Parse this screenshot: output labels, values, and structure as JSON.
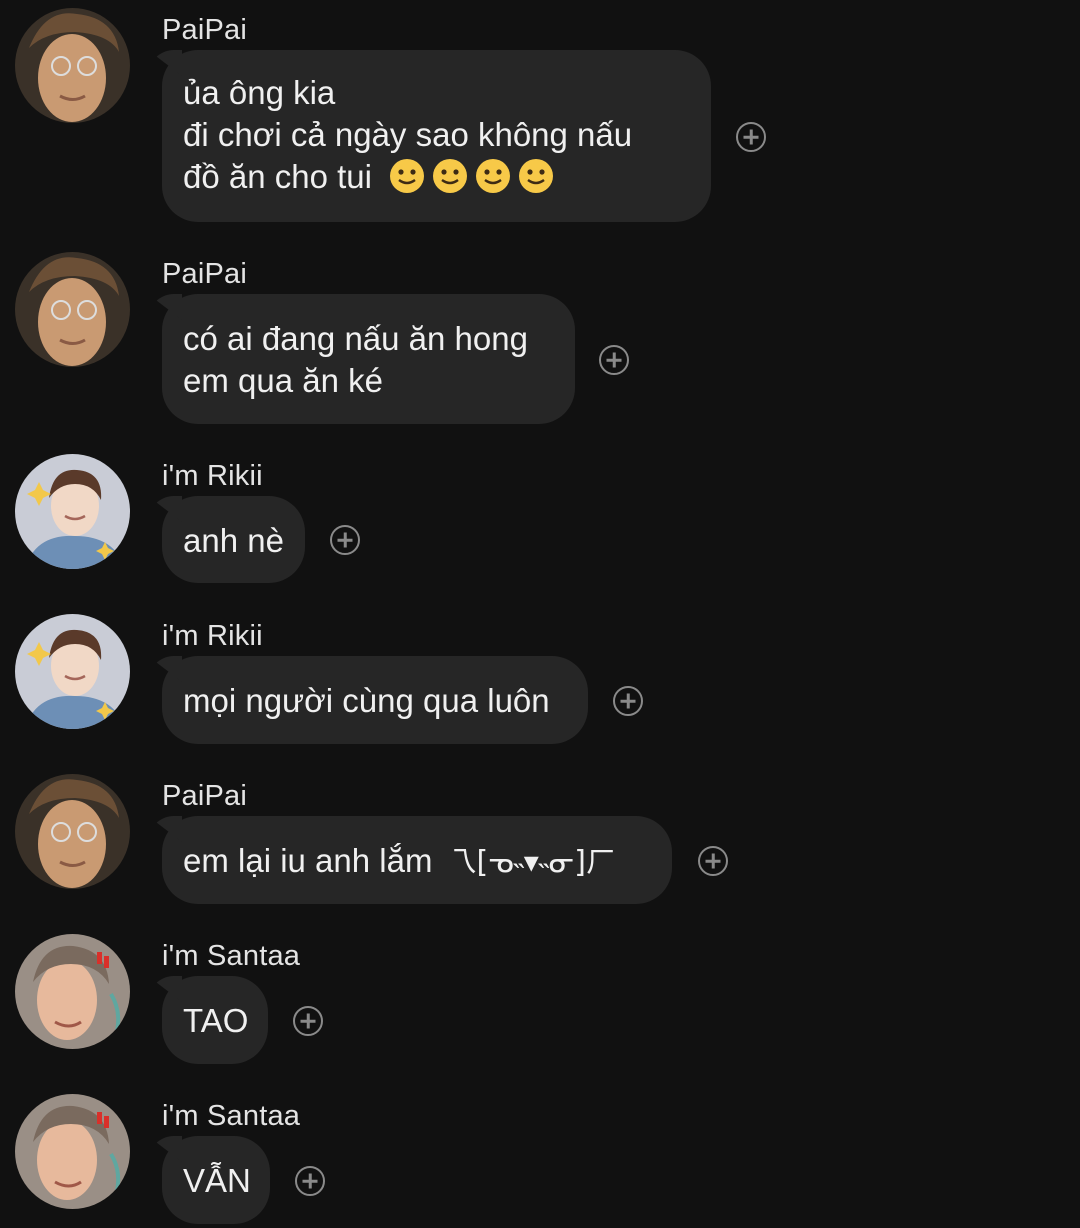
{
  "messages": [
    {
      "sender": "PaiPai",
      "avatar": "paipai",
      "lines": [
        "ủa ông kia",
        "đi chơi cả ngày sao không nấu",
        "đồ ăn cho tui"
      ],
      "emoji": [
        "slightly-smiling-face",
        "slightly-smiling-face",
        "slightly-smiling-face",
        "slightly-smiling-face"
      ]
    },
    {
      "sender": "PaiPai",
      "avatar": "paipai",
      "lines": [
        "có ai đang nấu ăn hong",
        "em qua ăn ké"
      ]
    },
    {
      "sender": "i'm Rikii",
      "avatar": "rikii",
      "lines": [
        "anh nè"
      ]
    },
    {
      "sender": "i'm Rikii",
      "avatar": "rikii",
      "lines": [
        "mọi người cùng qua luôn"
      ]
    },
    {
      "sender": "PaiPai",
      "avatar": "paipai",
      "lines": [
        "em lại iu anh lắm"
      ],
      "kaomoji": "乁[ᓀ˵▾˵ᓂ]ㄏ"
    },
    {
      "sender": "i'm Santaa",
      "avatar": "santaa",
      "lines": [
        "TAO"
      ]
    },
    {
      "sender": "i'm Santaa",
      "avatar": "santaa",
      "lines": [
        "VẪN"
      ]
    }
  ],
  "add_reaction_icon": "plus-circle-icon",
  "colors": {
    "background": "#111111",
    "bubble": "#262626",
    "text": "#f0f0f0",
    "icon": "#8a8a8a"
  }
}
